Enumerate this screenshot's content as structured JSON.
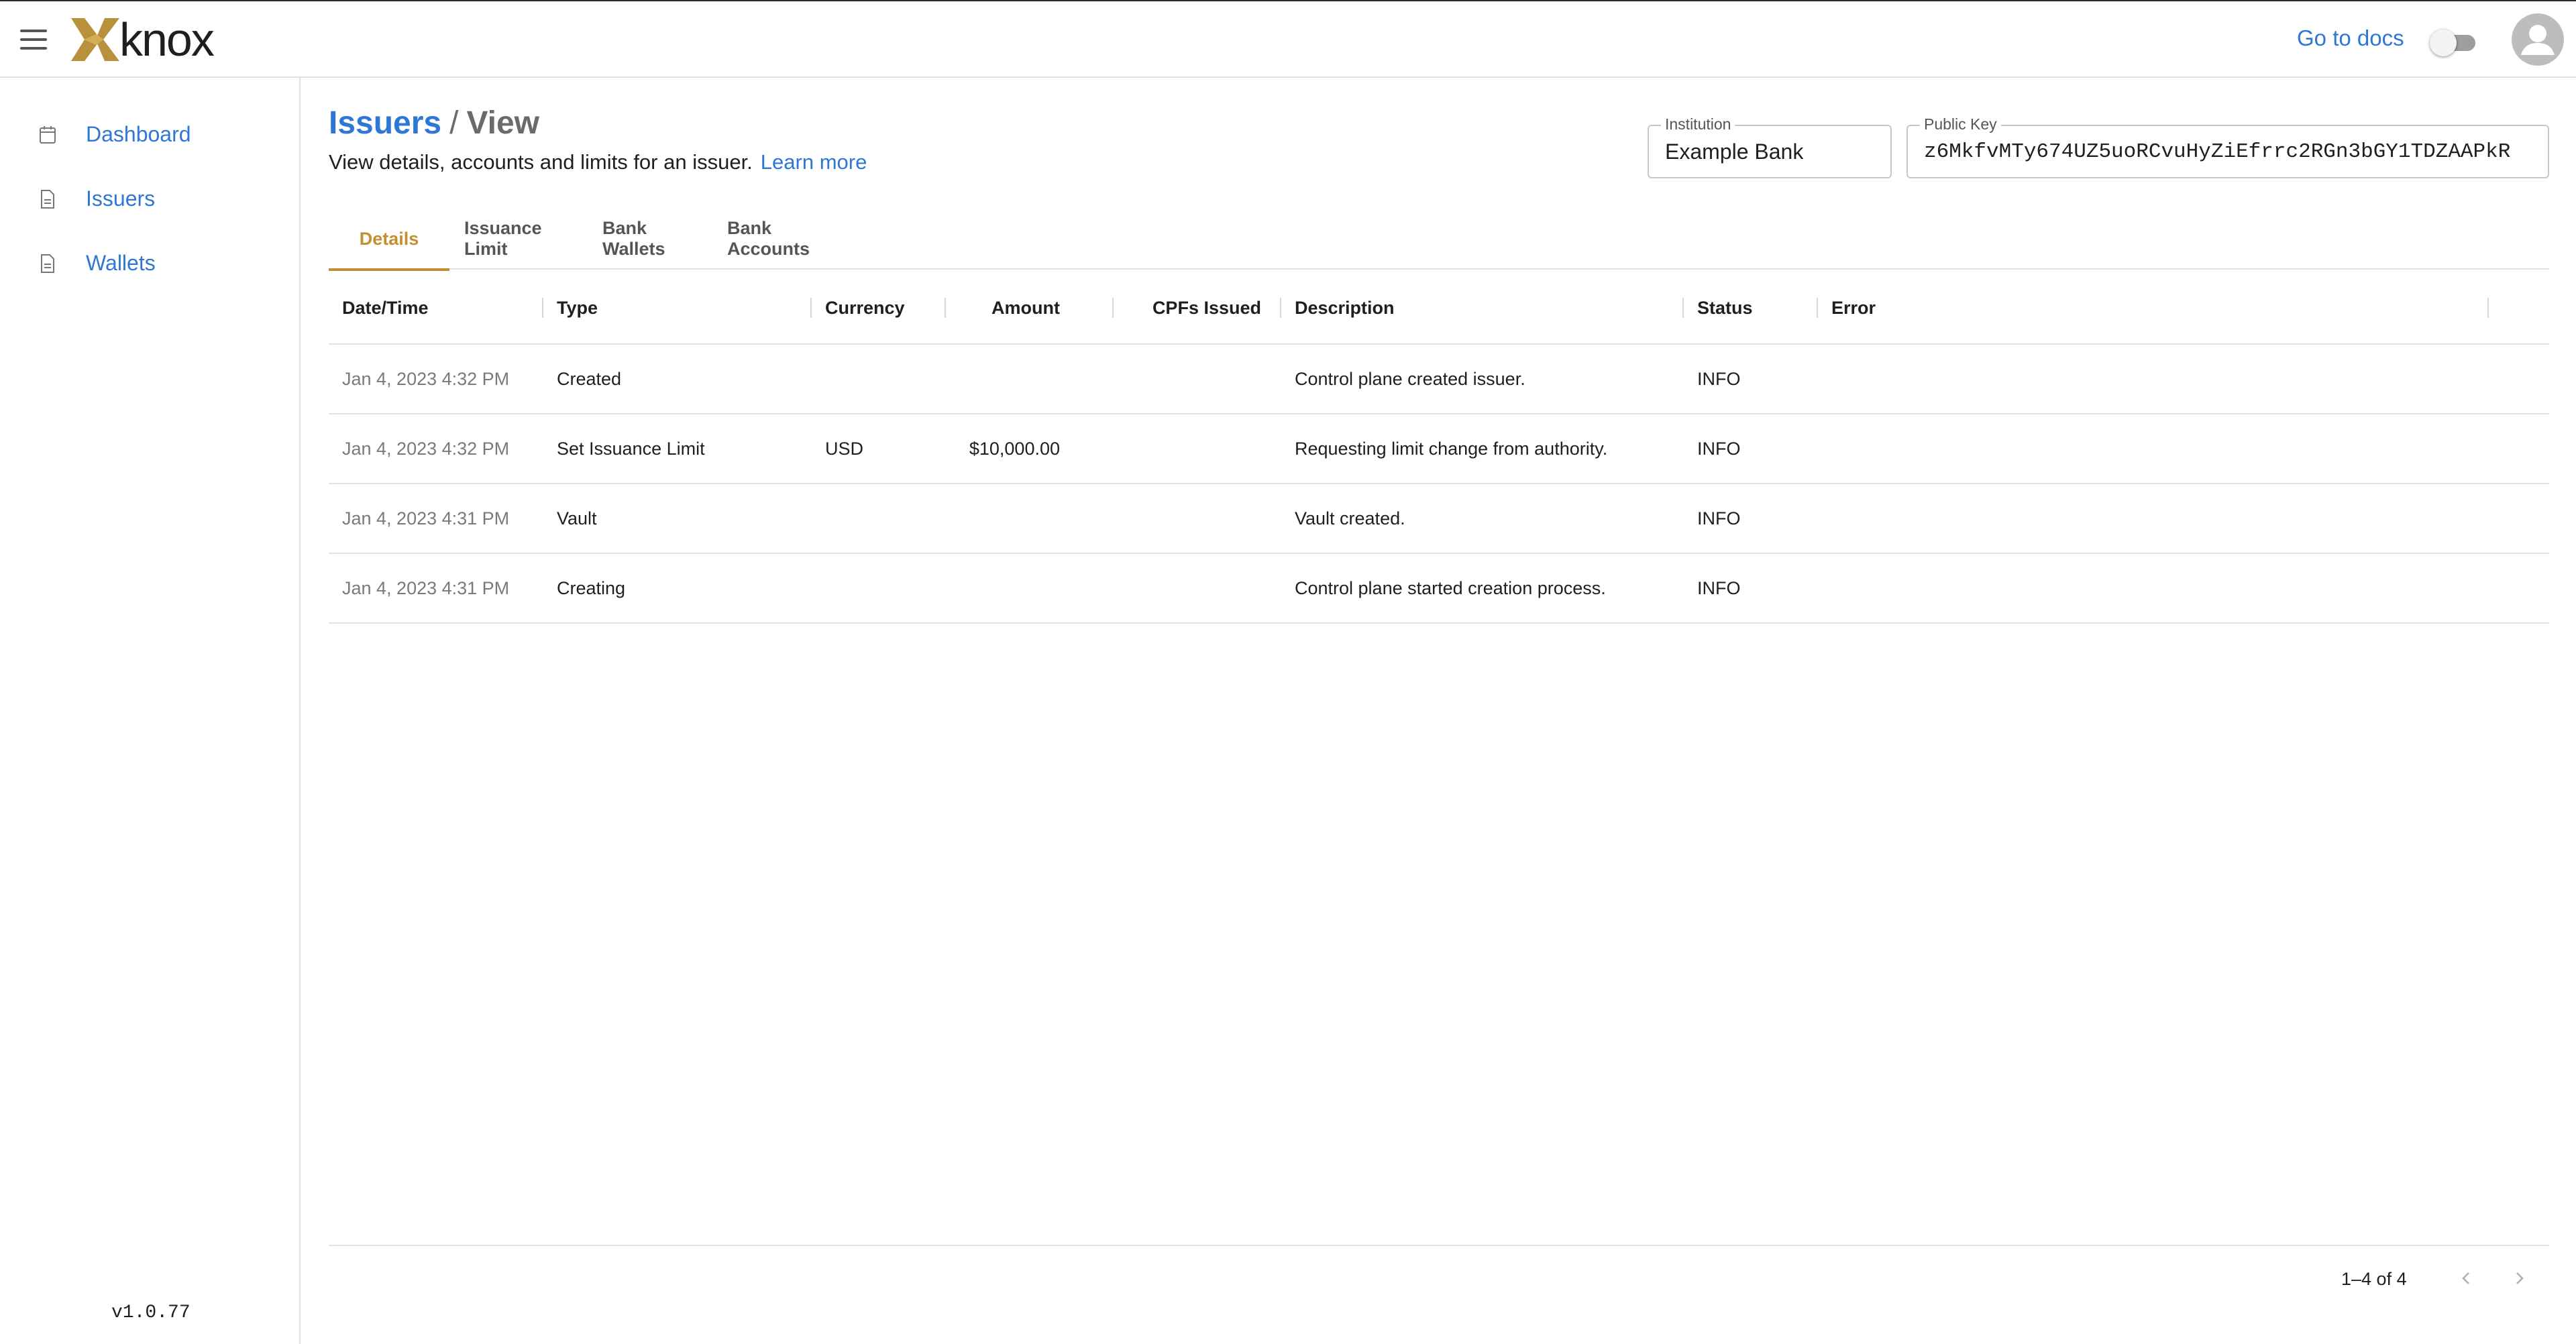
{
  "header": {
    "brand": "knox",
    "docs_link": "Go to docs"
  },
  "sidebar": {
    "items": [
      {
        "label": "Dashboard",
        "icon": "calendar-icon"
      },
      {
        "label": "Issuers",
        "icon": "document-icon"
      },
      {
        "label": "Wallets",
        "icon": "document-icon"
      }
    ],
    "version": "v1.0.77"
  },
  "breadcrumb": {
    "parent": "Issuers",
    "separator": "/",
    "current": "View"
  },
  "subtitle": {
    "text": "View details, accounts and limits for an issuer.",
    "link": "Learn more"
  },
  "fields": {
    "institution": {
      "label": "Institution",
      "value": "Example Bank"
    },
    "public_key": {
      "label": "Public Key",
      "value": "z6MkfvMTy674UZ5uoRCvuHyZiEfrrc2RGn3bGY1TDZAAPkR"
    }
  },
  "tabs": [
    "Details",
    "Issuance Limit",
    "Bank Wallets",
    "Bank Accounts"
  ],
  "table": {
    "columns": [
      "Date/Time",
      "Type",
      "Currency",
      "Amount",
      "CPFs Issued",
      "Description",
      "Status",
      "Error"
    ],
    "rows": [
      {
        "datetime": "Jan 4, 2023 4:32 PM",
        "type": "Created",
        "currency": "",
        "amount": "",
        "cpfs": "",
        "description": "Control plane created issuer.",
        "status": "INFO",
        "error": ""
      },
      {
        "datetime": "Jan 4, 2023 4:32 PM",
        "type": "Set Issuance Limit",
        "currency": "USD",
        "amount": "$10,000.00",
        "cpfs": "",
        "description": "Requesting limit change from authority.",
        "status": "INFO",
        "error": ""
      },
      {
        "datetime": "Jan 4, 2023 4:31 PM",
        "type": "Vault",
        "currency": "",
        "amount": "",
        "cpfs": "",
        "description": "Vault created.",
        "status": "INFO",
        "error": ""
      },
      {
        "datetime": "Jan 4, 2023 4:31 PM",
        "type": "Creating",
        "currency": "",
        "amount": "",
        "cpfs": "",
        "description": "Control plane started creation process.",
        "status": "INFO",
        "error": ""
      }
    ]
  },
  "pagination": {
    "range": "1–4 of 4"
  },
  "colors": {
    "link": "#2f77d6",
    "accent": "#c29030",
    "logo_gold": "#b8913a"
  }
}
